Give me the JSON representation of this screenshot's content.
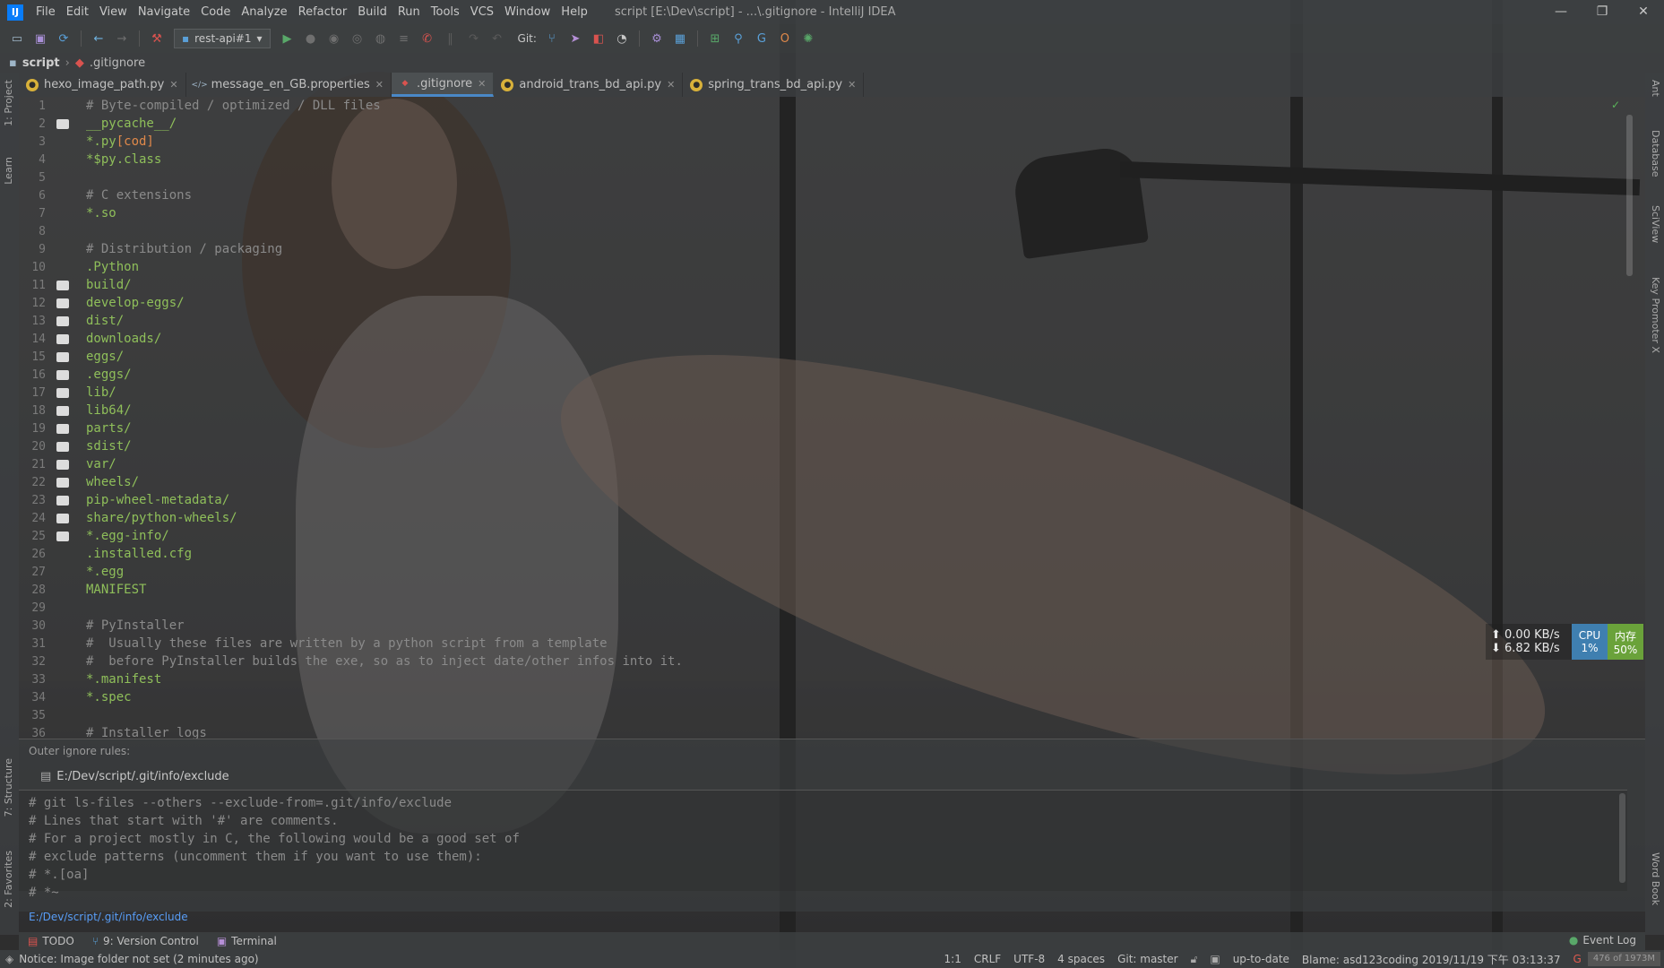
{
  "window": {
    "title": "script [E:\\Dev\\script] - ...\\.gitignore - IntelliJ IDEA",
    "app_logo": "IJ",
    "controls": [
      "—",
      "❐",
      "✕"
    ]
  },
  "menu": [
    "File",
    "Edit",
    "View",
    "Navigate",
    "Code",
    "Analyze",
    "Refactor",
    "Build",
    "Run",
    "Tools",
    "VCS",
    "Window",
    "Help"
  ],
  "toolbar": {
    "run_config": "rest-api#1",
    "git_label": "Git:"
  },
  "breadcrumb": {
    "project": "script",
    "file": ".gitignore"
  },
  "left_tool_windows": [
    "1: Project",
    "Learn",
    "7: Structure",
    "2: Favorites"
  ],
  "right_tool_windows": [
    "Ant",
    "Database",
    "SciView",
    "Key Promoter X",
    "Word Book"
  ],
  "tabs": [
    {
      "label": "hexo_image_path.py",
      "icon": "python-file-icon"
    },
    {
      "label": "message_en_GB.properties",
      "icon": "properties-file-icon"
    },
    {
      "label": ".gitignore",
      "icon": "gitignore-file-icon",
      "active": true
    },
    {
      "label": "android_trans_bd_api.py",
      "icon": "python-file-icon"
    },
    {
      "label": "spring_trans_bd_api.py",
      "icon": "python-file-icon"
    }
  ],
  "editor": {
    "lines": [
      {
        "n": "1",
        "text": "# Byte-compiled / optimized / DLL files",
        "kind": "comment",
        "folder": false
      },
      {
        "n": "2",
        "text": "__pycache__/",
        "kind": "path",
        "folder": true
      },
      {
        "n": "3",
        "text": "*.py",
        "suffix": "[cod]",
        "kind": "path",
        "folder": false
      },
      {
        "n": "4",
        "text": "*$py.class",
        "kind": "path",
        "folder": false
      },
      {
        "n": "5",
        "text": "",
        "kind": "blank",
        "folder": false
      },
      {
        "n": "6",
        "text": "# C extensions",
        "kind": "comment",
        "folder": false
      },
      {
        "n": "7",
        "text": "*.so",
        "kind": "path",
        "folder": false
      },
      {
        "n": "8",
        "text": "",
        "kind": "blank",
        "folder": false
      },
      {
        "n": "9",
        "text": "# Distribution / packaging",
        "kind": "comment",
        "folder": false
      },
      {
        "n": "10",
        "text": ".Python",
        "kind": "path",
        "folder": false
      },
      {
        "n": "11",
        "text": "build/",
        "kind": "path",
        "folder": true
      },
      {
        "n": "12",
        "text": "develop-eggs/",
        "kind": "path",
        "folder": true
      },
      {
        "n": "13",
        "text": "dist/",
        "kind": "path",
        "folder": true
      },
      {
        "n": "14",
        "text": "downloads/",
        "kind": "path",
        "folder": true
      },
      {
        "n": "15",
        "text": "eggs/",
        "kind": "path",
        "folder": true
      },
      {
        "n": "16",
        "text": ".eggs/",
        "kind": "path",
        "folder": true
      },
      {
        "n": "17",
        "text": "lib/",
        "kind": "path",
        "folder": true
      },
      {
        "n": "18",
        "text": "lib64/",
        "kind": "path",
        "folder": true
      },
      {
        "n": "19",
        "text": "parts/",
        "kind": "path",
        "folder": true
      },
      {
        "n": "20",
        "text": "sdist/",
        "kind": "path",
        "folder": true
      },
      {
        "n": "21",
        "text": "var/",
        "kind": "path",
        "folder": true
      },
      {
        "n": "22",
        "text": "wheels/",
        "kind": "path",
        "folder": true
      },
      {
        "n": "23",
        "text": "pip-wheel-metadata/",
        "kind": "path",
        "folder": true
      },
      {
        "n": "24",
        "text": "share/python-wheels/",
        "kind": "path",
        "folder": true
      },
      {
        "n": "25",
        "text": "*.egg-info/",
        "kind": "path",
        "folder": true
      },
      {
        "n": "26",
        "text": ".installed.cfg",
        "kind": "path",
        "folder": false
      },
      {
        "n": "27",
        "text": "*.egg",
        "kind": "path",
        "folder": false
      },
      {
        "n": "28",
        "text": "MANIFEST",
        "kind": "path",
        "folder": false
      },
      {
        "n": "29",
        "text": "",
        "kind": "blank",
        "folder": false
      },
      {
        "n": "30",
        "text": "# PyInstaller",
        "kind": "comment",
        "folder": false
      },
      {
        "n": "31",
        "text": "#  Usually these files are written by a python script from a template",
        "kind": "comment",
        "folder": false
      },
      {
        "n": "32",
        "text": "#  before PyInstaller builds the exe, so as to inject date/other infos into it.",
        "kind": "comment",
        "folder": false
      },
      {
        "n": "33",
        "text": "*.manifest",
        "kind": "path",
        "folder": false
      },
      {
        "n": "34",
        "text": "*.spec",
        "kind": "path",
        "folder": false
      },
      {
        "n": "35",
        "text": "",
        "kind": "blank",
        "folder": false
      },
      {
        "n": "36",
        "text": "# Installer logs",
        "kind": "comment",
        "folder": false
      }
    ]
  },
  "net_monitor": {
    "upload": "0.00 KB/s",
    "download": "6.82 KB/s",
    "cpu_label": "CPU",
    "cpu_value": "1%",
    "mem_label": "内存",
    "mem_value": "50%"
  },
  "outer_ignore": {
    "label": "Outer ignore rules:",
    "file": "E:/Dev/script/.git/info/exclude",
    "lines": [
      "# git ls-files --others --exclude-from=.git/info/exclude",
      "# Lines that start with '#' are comments.",
      "# For a project mostly in C, the following would be a good set of",
      "# exclude patterns (uncomment them if you want to use them):",
      "# *.[oa]",
      "# *~"
    ],
    "link": "E:/Dev/script/.git/info/exclude"
  },
  "bottom_tabs": [
    {
      "label": "TODO",
      "icon": "todo-icon"
    },
    {
      "label": "9: Version Control",
      "icon": "version-control-icon"
    },
    {
      "label": "Terminal",
      "icon": "terminal-icon"
    }
  ],
  "event_log": "Event Log",
  "status": {
    "notice": "Notice: Image folder not set (2 minutes ago)",
    "position": "1:1",
    "line_sep": "CRLF",
    "encoding": "UTF-8",
    "indent": "4 spaces",
    "git": "Git: master",
    "sync": "up-to-date",
    "blame": "Blame: asd123coding 2019/11/19 下午 03:13:37",
    "memory": "476 of 1973M"
  },
  "colors": {
    "accent": "#4a88c7",
    "code_path": "#8fbf5a",
    "comment": "#8a8a8a",
    "bracket": "#e0894a",
    "cpu": "#3f7fb0",
    "mem": "#6aa23a",
    "link": "#589df6"
  }
}
